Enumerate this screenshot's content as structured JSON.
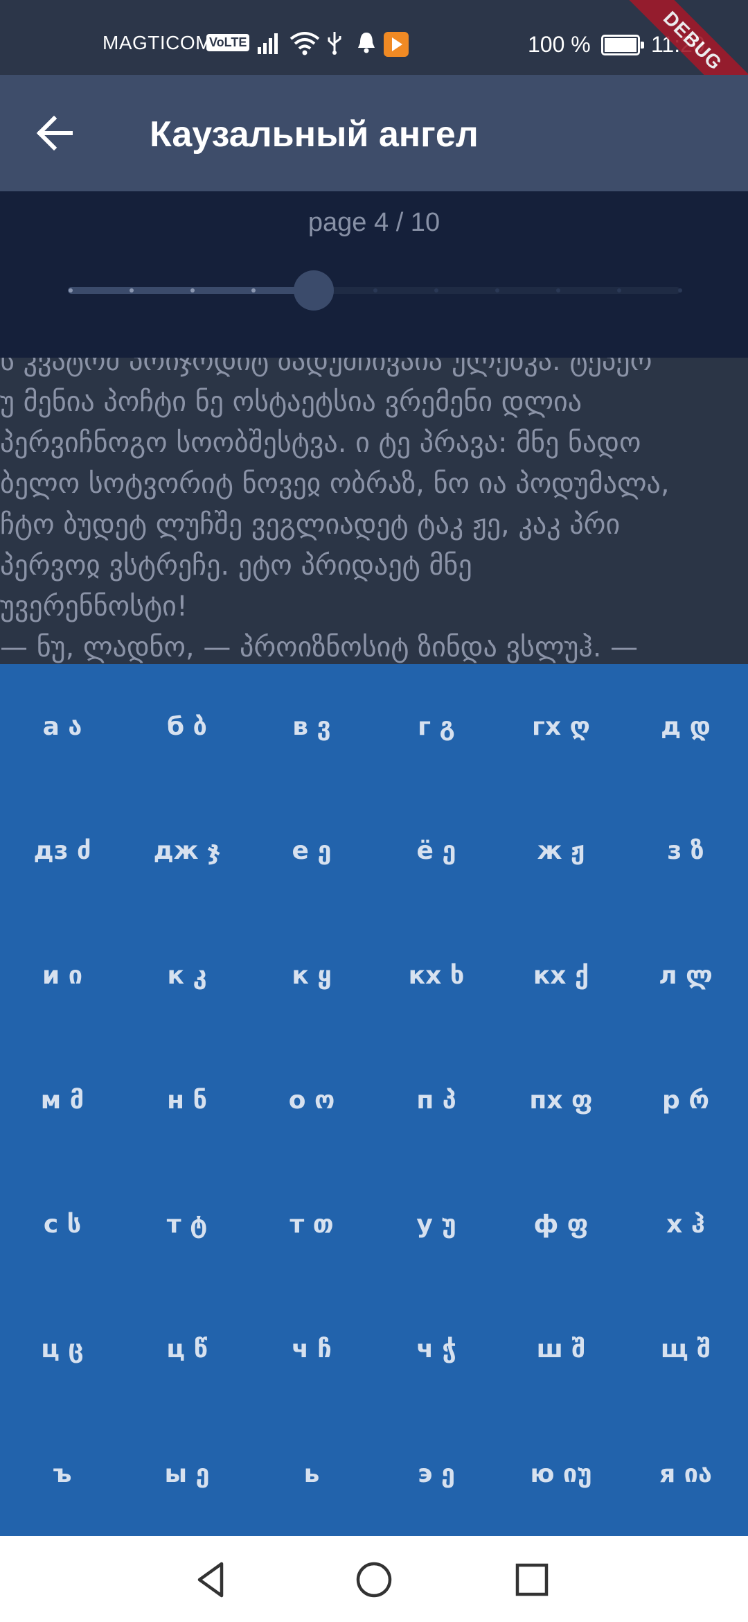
{
  "status_bar": {
    "carrier": "MAGTICOM",
    "volte": "VoLTE",
    "battery": "100 %",
    "time": "11:20",
    "debug": "DEBUG"
  },
  "app_bar": {
    "title": "Каузальный ангел"
  },
  "pager": {
    "label": "page 4 / 10",
    "current_page": 4,
    "total_pages": 10
  },
  "reader": {
    "text": "ს კვატოძ პრიჯოდიტ ზადუმჩივაია ულებკა. ტეპერ\nუ მენია პოჩტი ნე ოსტაეტსია ვრემენი დლია\nპერვიჩნოგო სოობშესტვა. ი ტე პრავა: მნე ნადო\nბელო სოტვორიტ ნოვეჲ ობრაზ, ნო ია პოდუმალა,\nჩტო ბუდეტ ლუჩშე ვეგლიადეტ ტაკ ჟე, კაკ პრი\nპერვოჲ ვსტრეჩე. ეტო პრიდაეტ მნე\nუვერენნოსტი!\n— ნუ, ლადნო, — პროიზნოსიტ ზინდა ვსლუჰ. —"
  },
  "keyboard": {
    "rows": [
      [
        "а ა",
        "б ბ",
        "в ვ",
        "г გ",
        "гх ღ",
        "д დ"
      ],
      [
        "дз ძ",
        "дж ჯ",
        "е ე",
        "ё ე",
        "ж ჟ",
        "з ზ"
      ],
      [
        "и ი",
        "к კ",
        "к ყ",
        "кх ხ",
        "кх ქ",
        "л ლ"
      ],
      [
        "м მ",
        "н ნ",
        "о ო",
        "п პ",
        "пх ფ",
        "р რ"
      ],
      [
        "с ს",
        "т ტ",
        "т თ",
        "у უ",
        "ф ფ",
        "х ჰ"
      ],
      [
        "ц ც",
        "ц წ",
        "ч ჩ",
        "ч ჭ",
        "ш შ",
        "щ შ"
      ],
      [
        "ъ",
        "ы ე",
        "ь",
        "э ე",
        "ю იუ",
        "я ია"
      ]
    ]
  },
  "colors": {
    "status_bar": "#2c3649",
    "app_bar": "#3e4d6a",
    "pager_bg": "#15203a",
    "reader_bg": "#2b3546",
    "keyboard_bg": "#2263ac",
    "key_text": "#d7e1ef"
  },
  "icons": {
    "back": "arrow-left-icon",
    "nav_back": "triangle-back-icon",
    "nav_home": "circle-home-icon",
    "nav_recents": "square-recents-icon"
  }
}
